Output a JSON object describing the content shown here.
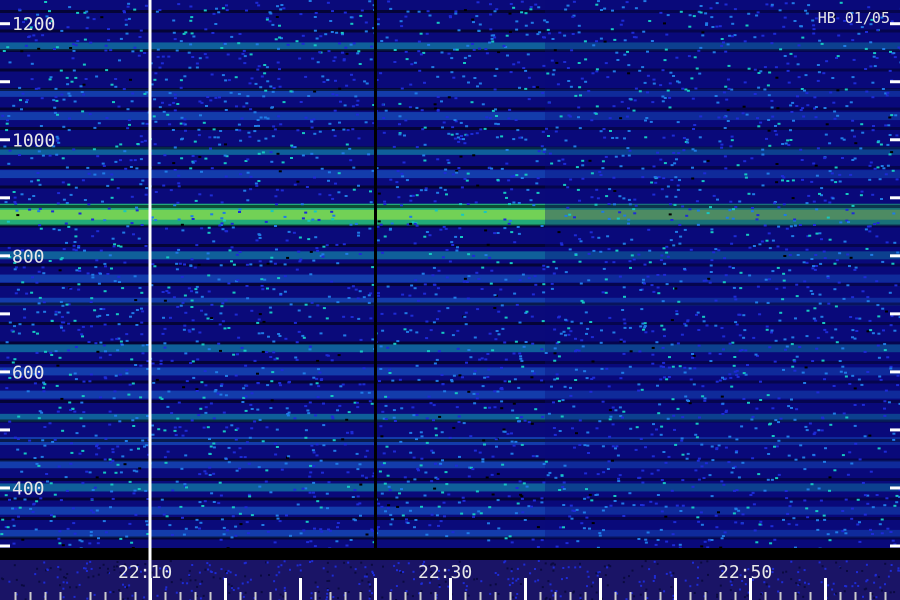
{
  "chart_data": {
    "type": "heatmap",
    "title": "",
    "xlabel": "",
    "ylabel": "",
    "station_label": "HB 01/05",
    "x_range_minutes": [
      "22:00",
      "22:59"
    ],
    "y_range_hz": [
      275,
      1240
    ],
    "y_ticks": [
      {
        "value": 1200,
        "label": "1200"
      },
      {
        "value": 1100,
        "label": ""
      },
      {
        "value": 1000,
        "label": "1000"
      },
      {
        "value": 900,
        "label": ""
      },
      {
        "value": 800,
        "label": "800"
      },
      {
        "value": 700,
        "label": ""
      },
      {
        "value": 600,
        "label": "600"
      },
      {
        "value": 500,
        "label": ""
      },
      {
        "value": 400,
        "label": "400"
      },
      {
        "value": 300,
        "label": ""
      }
    ],
    "x_ticks": [
      {
        "time": "22:10",
        "label": "22:10",
        "major": true
      },
      {
        "time": "22:15",
        "label": "",
        "major": true
      },
      {
        "time": "22:20",
        "label": "",
        "major": true
      },
      {
        "time": "22:25",
        "label": "",
        "major": true
      },
      {
        "time": "22:30",
        "label": "22:30",
        "major": true
      },
      {
        "time": "22:35",
        "label": "",
        "major": true
      },
      {
        "time": "22:40",
        "label": "",
        "major": true
      },
      {
        "time": "22:45",
        "label": "",
        "major": true
      },
      {
        "time": "22:50",
        "label": "22:50",
        "major": true
      },
      {
        "time": "22:55",
        "label": "",
        "major": true
      }
    ],
    "marker_time": "22:10",
    "data_gap_time": "22:25",
    "band_frequencies_hz": [
      1160,
      1080,
      1040,
      980,
      940,
      870,
      800,
      760,
      720,
      640,
      600,
      560,
      520,
      480,
      440,
      400,
      360,
      320
    ],
    "strong_band_hz": 870,
    "colorscale": [
      "#000000",
      "#0a0a7a",
      "#1d2bd6",
      "#1f7be6",
      "#16c7c2",
      "#29e07a",
      "#b6f03a"
    ],
    "grid": false,
    "legend": "none"
  }
}
